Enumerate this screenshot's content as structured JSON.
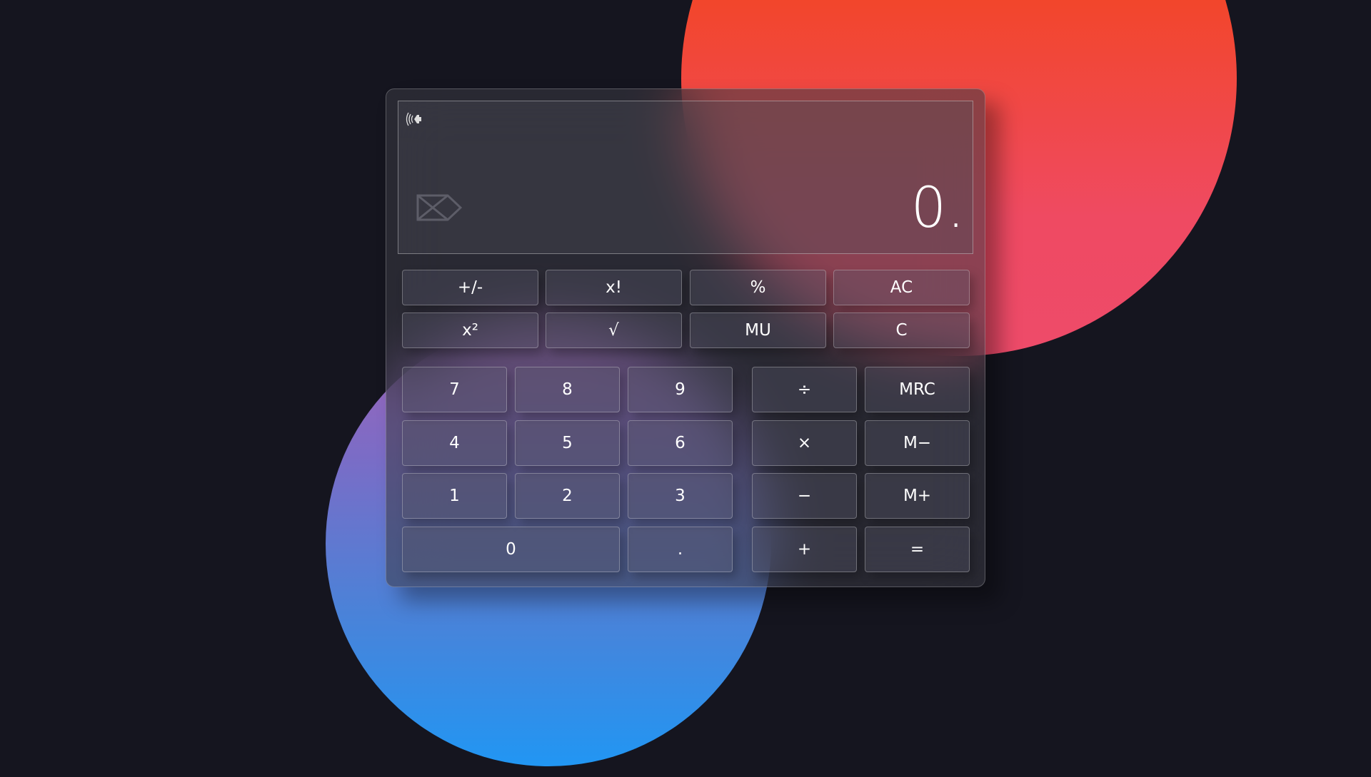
{
  "display": {
    "value": "0.",
    "speaker_icon": "speaker-icon",
    "backspace_icon": "backspace-icon"
  },
  "function_keys": [
    {
      "label": "+/-",
      "name": "plus-minus-button"
    },
    {
      "label": "x!",
      "name": "factorial-button"
    },
    {
      "label": "%",
      "name": "percent-button"
    },
    {
      "label": "AC",
      "name": "all-clear-button"
    },
    {
      "label": "x²",
      "name": "square-button"
    },
    {
      "label": "√",
      "name": "sqrt-button"
    },
    {
      "label": "MU",
      "name": "mu-button"
    },
    {
      "label": "C",
      "name": "clear-button"
    }
  ],
  "keypad": [
    {
      "label": "7",
      "name": "digit-7-button"
    },
    {
      "label": "8",
      "name": "digit-8-button"
    },
    {
      "label": "9",
      "name": "digit-9-button"
    },
    {
      "label": "÷",
      "name": "divide-button"
    },
    {
      "label": "MRC",
      "name": "memory-recall-button"
    },
    {
      "label": "4",
      "name": "digit-4-button"
    },
    {
      "label": "5",
      "name": "digit-5-button"
    },
    {
      "label": "6",
      "name": "digit-6-button"
    },
    {
      "label": "×",
      "name": "multiply-button"
    },
    {
      "label": "M−",
      "name": "memory-minus-button"
    },
    {
      "label": "1",
      "name": "digit-1-button"
    },
    {
      "label": "2",
      "name": "digit-2-button"
    },
    {
      "label": "3",
      "name": "digit-3-button"
    },
    {
      "label": "−",
      "name": "subtract-button"
    },
    {
      "label": "M+",
      "name": "memory-plus-button"
    },
    {
      "label": "0",
      "name": "digit-0-button"
    },
    {
      "label": ".",
      "name": "decimal-button"
    },
    {
      "label": "+",
      "name": "add-button"
    },
    {
      "label": "=",
      "name": "equals-button"
    }
  ]
}
